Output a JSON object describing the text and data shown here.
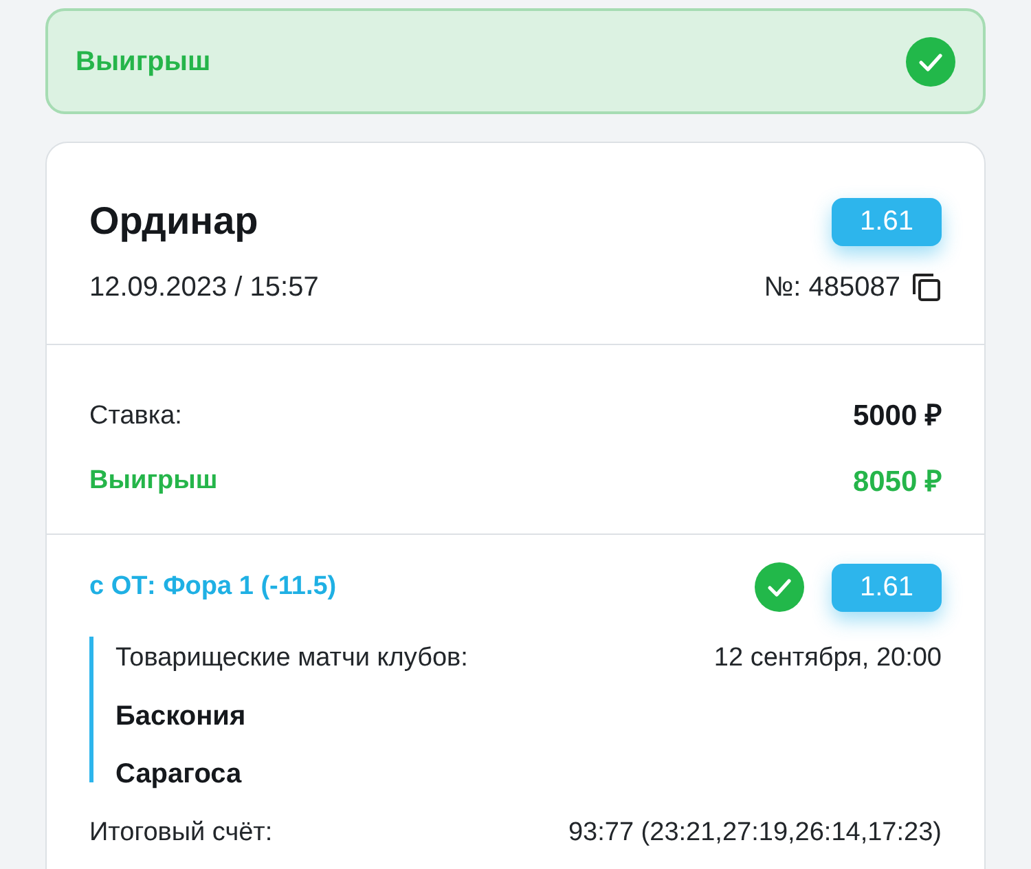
{
  "status_banner": {
    "label": "Выигрыш",
    "won": true
  },
  "bet": {
    "type": "Ординар",
    "odds": "1.61",
    "datetime": "12.09.2023 / 15:57",
    "number": "№: 485087",
    "summary": [
      {
        "kind": "stake",
        "label": "Ставка:",
        "value": "5000 ₽"
      },
      {
        "kind": "win",
        "label": "Выигрыш",
        "value": "8050 ₽"
      }
    ],
    "selections": [
      {
        "market": "с ОТ: Фора 1 (-11.5)",
        "won": true,
        "odds": "1.61",
        "tournament": "Товарищеские матчи клубов:",
        "date": "12 сентября, 20:00",
        "teams": [
          "Баскония",
          "Сарагоса"
        ],
        "score_label": "Итоговый счёт:",
        "score": "93:77 (23:21,27:19,26:14,17:23)"
      }
    ]
  }
}
